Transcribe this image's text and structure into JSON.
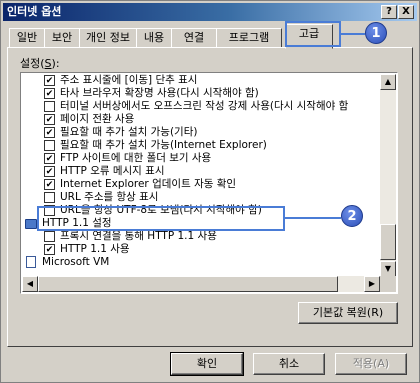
{
  "window": {
    "title": "인터넷 옵션",
    "help_label": "?",
    "close_label": "X"
  },
  "tabs": [
    {
      "label": "일반"
    },
    {
      "label": "보안"
    },
    {
      "label": "개인 정보"
    },
    {
      "label": "내용"
    },
    {
      "label": "연결"
    },
    {
      "label": "프로그램"
    },
    {
      "label": "고급"
    }
  ],
  "settings": {
    "label_prefix": "설정(",
    "label_key": "S",
    "label_suffix": "):"
  },
  "list_items": [
    {
      "text": "주소 표시줄에 [이동] 단추 표시",
      "checked": true
    },
    {
      "text": "타사 브라우저 확장명 사용(다시 시작해야 함)",
      "checked": true
    },
    {
      "text": "터미널 서버상에서도 오프스크린 작성 강제 사용(다시 시작해야 함",
      "checked": false
    },
    {
      "text": "페이지 전환 사용",
      "checked": true
    },
    {
      "text": "필요할 때 추가 설치 가능(기타)",
      "checked": true
    },
    {
      "text": "필요할 때 추가 설치 가능(Internet Explorer)",
      "checked": false
    },
    {
      "text": "FTP 사이트에 대한 폴더 보기 사용",
      "checked": true
    },
    {
      "text": "HTTP 오류 메시지 표시",
      "checked": true
    },
    {
      "text": "Internet Explorer 업데이트 자동 확인",
      "checked": true
    },
    {
      "text": "URL 주소를 항상 표시",
      "checked": false
    },
    {
      "text": "URL을 항상 UTF-8로 보냄(다시 시작해야 함)",
      "checked": false
    },
    {
      "text": "HTTP 1.1 설정",
      "group": "folder"
    },
    {
      "text": "프록시 연결을 통해 HTTP 1.1 사용",
      "checked": false
    },
    {
      "text": "HTTP 1.1 사용",
      "checked": true
    },
    {
      "text": "Microsoft VM",
      "group": "doc"
    }
  ],
  "buttons": {
    "restore_defaults": "기본값 복원(R)",
    "ok": "확인",
    "cancel": "취소",
    "apply": "적용(A)"
  },
  "annotations": [
    {
      "number": "1"
    },
    {
      "number": "2"
    }
  ],
  "colors": {
    "callout": "#4a7cd6",
    "titlebar_start": "#0a246a",
    "face": "#d4d0c8"
  }
}
